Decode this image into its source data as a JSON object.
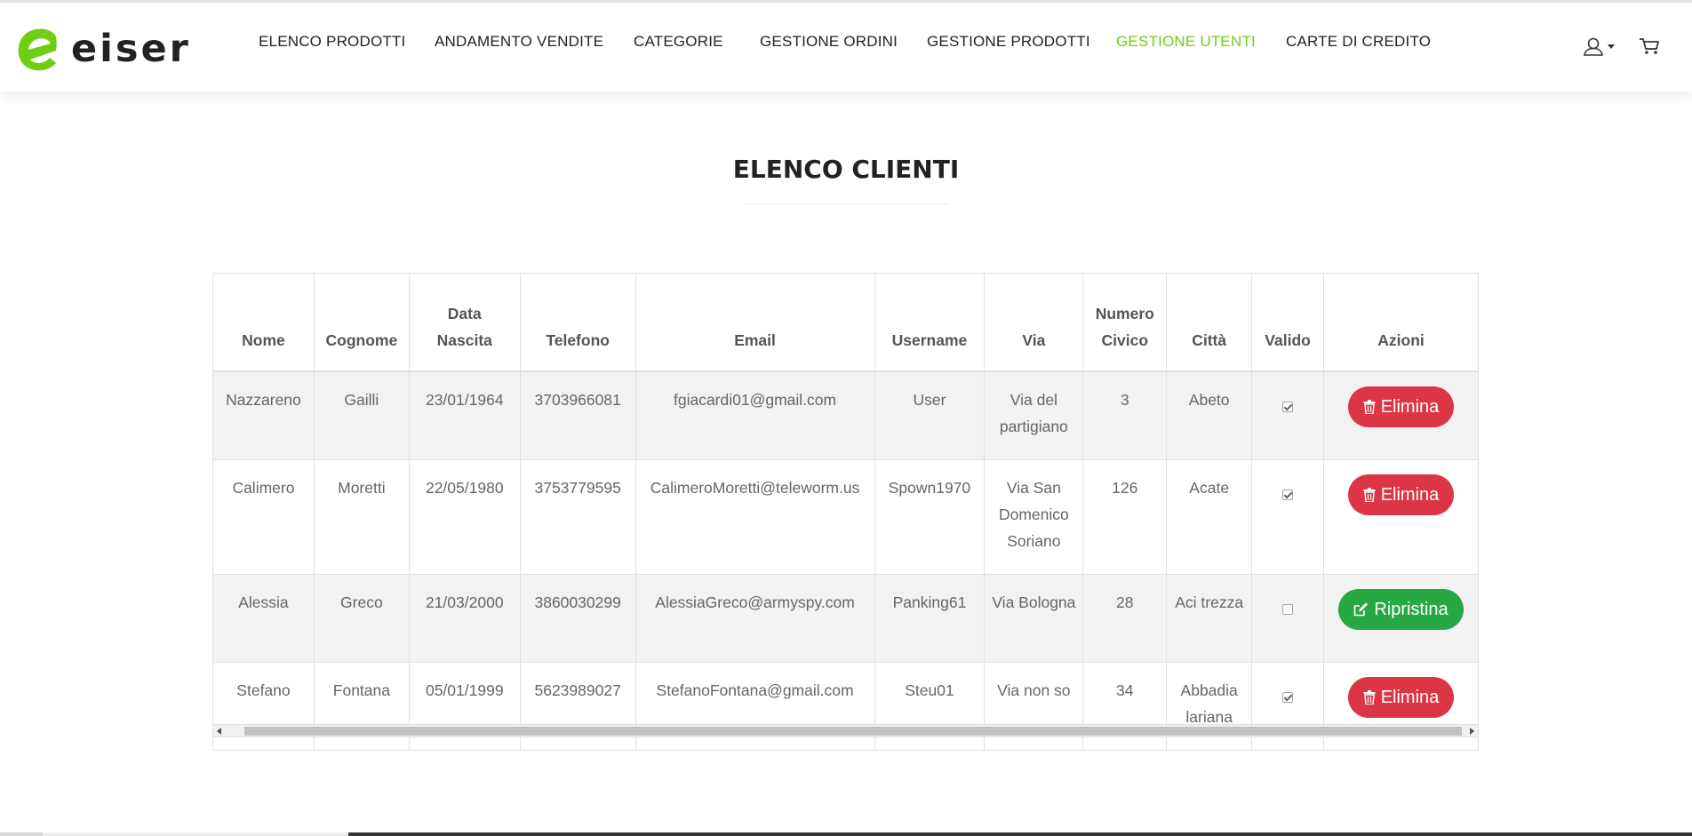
{
  "brand": {
    "name": "eiser",
    "accent_color": "#71cd14"
  },
  "nav": {
    "items": [
      {
        "label": "ELENCO PRODOTTI",
        "active": false
      },
      {
        "label": "ANDAMENTO VENDITE",
        "active": false
      },
      {
        "label": "CATEGORIE",
        "active": false
      },
      {
        "label": "GESTIONE ORDINI",
        "active": false
      },
      {
        "label": "GESTIONE PRODOTTI",
        "active": false
      },
      {
        "label": "GESTIONE UTENTI",
        "active": true
      },
      {
        "label": "CARTE DI CREDITO",
        "active": false
      }
    ],
    "icons": [
      "user-icon",
      "cart-icon"
    ]
  },
  "page": {
    "title": "ELENCO CLIENTI"
  },
  "table": {
    "headers": {
      "nome": "Nome",
      "cognome": "Cognome",
      "data_nascita_1": "Data",
      "data_nascita_2": "Nascita",
      "telefono": "Telefono",
      "email": "Email",
      "username": "Username",
      "via": "Via",
      "numero_civico_1": "Numero",
      "numero_civico_2": "Civico",
      "citta": "Città",
      "valido": "Valido",
      "azioni": "Azioni"
    },
    "rows": [
      {
        "nome": "Nazzareno",
        "cognome": "Gailli",
        "data_nascita": "23/01/1964",
        "telefono": "3703966081",
        "email": "fgiacardi01@gmail.com",
        "username": "User",
        "via": "Via del partigiano",
        "numero_civico": "3",
        "citta": "Abeto",
        "valido": true,
        "azione": "Elimina"
      },
      {
        "nome": "Calimero",
        "cognome": "Moretti",
        "data_nascita": "22/05/1980",
        "telefono": "3753779595",
        "email": "CalimeroMoretti@teleworm.us",
        "username": "Spown1970",
        "via": "Via San Domenico Soriano",
        "numero_civico": "126",
        "citta": "Acate",
        "valido": true,
        "azione": "Elimina"
      },
      {
        "nome": "Alessia",
        "cognome": "Greco",
        "data_nascita": "21/03/2000",
        "telefono": "3860030299",
        "email": "AlessiaGreco@armyspy.com",
        "username": "Panking61",
        "via": "Via Bologna",
        "numero_civico": "28",
        "citta": "Aci trezza",
        "valido": false,
        "azione": "Ripristina"
      },
      {
        "nome": "Stefano",
        "cognome": "Fontana",
        "data_nascita": "05/01/1999",
        "telefono": "5623989027",
        "email": "StefanoFontana@gmail.com",
        "username": "Steu01",
        "via": "Via non so",
        "numero_civico": "34",
        "citta": "Abbadia lariana",
        "valido": true,
        "azione": "Elimina"
      }
    ]
  },
  "colors": {
    "delete": "#dc3545",
    "restore": "#28a745",
    "accent": "#71cd14"
  }
}
